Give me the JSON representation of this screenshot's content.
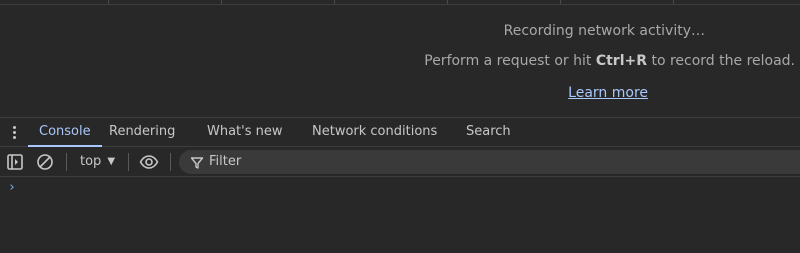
{
  "network": {
    "recording_text": "Recording network activity…",
    "hint_prefix": "Perform a request or hit ",
    "hint_shortcut": "Ctrl+R",
    "hint_suffix": " to record the reload.",
    "learn_more": "Learn more"
  },
  "drawer": {
    "menu_icon": "more-vert-icon",
    "tabs": [
      {
        "label": "Console",
        "active": true
      },
      {
        "label": "Rendering",
        "active": false
      },
      {
        "label": "What's new",
        "active": false
      },
      {
        "label": "Network conditions",
        "active": false
      },
      {
        "label": "Search",
        "active": false
      }
    ]
  },
  "console_toolbar": {
    "sidebar_icon": "sidebar-toggle-icon",
    "clear_icon": "clear-console-icon",
    "context": "top",
    "eye_icon": "eye-icon",
    "filter_icon": "filter-icon",
    "filter_placeholder": "Filter"
  },
  "console": {
    "prompt_symbol": "›"
  },
  "colors": {
    "background": "#282828",
    "text": "#c7c7c7",
    "muted_text": "#a8a8a8",
    "accent": "#a8c7fa",
    "filter_bg": "#3a3a3a",
    "prompt": "#7cacf8"
  }
}
